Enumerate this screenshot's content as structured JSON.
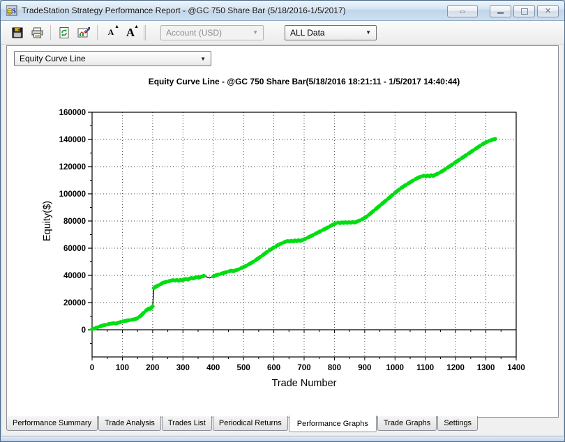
{
  "window": {
    "title": "TradeStation Strategy Performance Report - @GC 750 Share Bar (5/18/2016-1/5/2017)",
    "controls": {
      "resize_glyph": "⇔",
      "close_glyph": "✕"
    }
  },
  "toolbar": {
    "buttons": [
      "save",
      "print",
      "refresh",
      "format-report",
      "font-decrease",
      "font-increase"
    ],
    "account_combo": {
      "value": "Account (USD)",
      "disabled": true
    },
    "range_combo": {
      "value": "ALL Data",
      "disabled": false
    }
  },
  "graph_selector": {
    "value": "Equity Curve Line"
  },
  "tabs": {
    "items": [
      {
        "label": "Performance Summary",
        "active": false
      },
      {
        "label": "Trade Analysis",
        "active": false
      },
      {
        "label": "Trades List",
        "active": false
      },
      {
        "label": "Periodical Returns",
        "active": false
      },
      {
        "label": "Performance Graphs",
        "active": true
      },
      {
        "label": "Trade Graphs",
        "active": false
      },
      {
        "label": "Settings",
        "active": false
      }
    ]
  },
  "chart_data": {
    "type": "line",
    "title": "Equity Curve Line - @GC 750 Share Bar(5/18/2016 18:21:11 - 1/5/2017 14:40:44)",
    "xlabel": "Trade Number",
    "ylabel": "Equity($)",
    "xlim": [
      0,
      1400
    ],
    "ylim": [
      -20000,
      160000
    ],
    "x_major": 100,
    "x_minor": 50,
    "y_major": 20000,
    "y_minor": 10000,
    "grid": "dotted",
    "legend": "none",
    "line_color": "#000000",
    "new_high_color": "#00dd11",
    "series": [
      {
        "name": "Equity",
        "points": [
          [
            0,
            500
          ],
          [
            8,
            900
          ],
          [
            16,
            1600
          ],
          [
            24,
            2300
          ],
          [
            32,
            2900
          ],
          [
            40,
            3400
          ],
          [
            48,
            3800
          ],
          [
            56,
            4200
          ],
          [
            64,
            4500
          ],
          [
            72,
            4900
          ],
          [
            78,
            4600
          ],
          [
            84,
            5000
          ],
          [
            90,
            5400
          ],
          [
            98,
            5900
          ],
          [
            106,
            6300
          ],
          [
            114,
            6700
          ],
          [
            122,
            7000
          ],
          [
            130,
            7300
          ],
          [
            138,
            7600
          ],
          [
            146,
            8100
          ],
          [
            152,
            8800
          ],
          [
            158,
            9800
          ],
          [
            164,
            11000
          ],
          [
            170,
            12400
          ],
          [
            176,
            13700
          ],
          [
            182,
            14800
          ],
          [
            188,
            15700
          ],
          [
            192,
            15300
          ],
          [
            196,
            16300
          ],
          [
            200,
            17300
          ],
          [
            202,
            24000
          ],
          [
            204,
            30600
          ],
          [
            208,
            31400
          ],
          [
            214,
            32100
          ],
          [
            220,
            32800
          ],
          [
            226,
            33500
          ],
          [
            232,
            34300
          ],
          [
            238,
            34800
          ],
          [
            244,
            35200
          ],
          [
            250,
            35600
          ],
          [
            256,
            35900
          ],
          [
            262,
            36200
          ],
          [
            268,
            36500
          ],
          [
            274,
            36100
          ],
          [
            280,
            36600
          ],
          [
            286,
            36000
          ],
          [
            292,
            36700
          ],
          [
            298,
            36300
          ],
          [
            304,
            37000
          ],
          [
            310,
            37400
          ],
          [
            316,
            36900
          ],
          [
            322,
            37600
          ],
          [
            328,
            38100
          ],
          [
            334,
            37700
          ],
          [
            340,
            38300
          ],
          [
            346,
            38700
          ],
          [
            352,
            38300
          ],
          [
            358,
            38900
          ],
          [
            364,
            39300
          ],
          [
            370,
            39700
          ],
          [
            376,
            39100
          ],
          [
            382,
            38500
          ],
          [
            388,
            38100
          ],
          [
            394,
            38700
          ],
          [
            400,
            39200
          ],
          [
            406,
            39800
          ],
          [
            412,
            40300
          ],
          [
            418,
            40700
          ],
          [
            424,
            41100
          ],
          [
            430,
            41500
          ],
          [
            436,
            41900
          ],
          [
            442,
            42300
          ],
          [
            448,
            42700
          ],
          [
            454,
            43100
          ],
          [
            460,
            43500
          ],
          [
            466,
            43000
          ],
          [
            472,
            43600
          ],
          [
            478,
            44000
          ],
          [
            484,
            44500
          ],
          [
            490,
            45100
          ],
          [
            496,
            45700
          ],
          [
            502,
            46300
          ],
          [
            510,
            47200
          ],
          [
            518,
            48200
          ],
          [
            526,
            49200
          ],
          [
            534,
            50300
          ],
          [
            542,
            51500
          ],
          [
            550,
            52700
          ],
          [
            558,
            54000
          ],
          [
            566,
            55300
          ],
          [
            574,
            56600
          ],
          [
            582,
            57900
          ],
          [
            590,
            59100
          ],
          [
            598,
            60200
          ],
          [
            606,
            61300
          ],
          [
            614,
            62300
          ],
          [
            622,
            63200
          ],
          [
            630,
            64000
          ],
          [
            638,
            64700
          ],
          [
            646,
            65300
          ],
          [
            652,
            64900
          ],
          [
            658,
            65500
          ],
          [
            664,
            65000
          ],
          [
            670,
            65700
          ],
          [
            676,
            65200
          ],
          [
            682,
            65900
          ],
          [
            688,
            65400
          ],
          [
            694,
            66000
          ],
          [
            700,
            66500
          ],
          [
            708,
            67300
          ],
          [
            716,
            68200
          ],
          [
            724,
            69100
          ],
          [
            732,
            70000
          ],
          [
            740,
            70900
          ],
          [
            748,
            71800
          ],
          [
            756,
            72700
          ],
          [
            764,
            73600
          ],
          [
            772,
            74500
          ],
          [
            780,
            75500
          ],
          [
            788,
            76500
          ],
          [
            796,
            77400
          ],
          [
            804,
            78200
          ],
          [
            812,
            78900
          ],
          [
            818,
            78400
          ],
          [
            824,
            79000
          ],
          [
            830,
            78500
          ],
          [
            836,
            79100
          ],
          [
            842,
            78600
          ],
          [
            848,
            79200
          ],
          [
            854,
            78700
          ],
          [
            860,
            79300
          ],
          [
            866,
            78800
          ],
          [
            872,
            79400
          ],
          [
            878,
            79900
          ],
          [
            886,
            80600
          ],
          [
            894,
            81500
          ],
          [
            902,
            82600
          ],
          [
            910,
            83900
          ],
          [
            918,
            85300
          ],
          [
            926,
            86800
          ],
          [
            934,
            88300
          ],
          [
            942,
            89800
          ],
          [
            950,
            91300
          ],
          [
            958,
            92800
          ],
          [
            966,
            94300
          ],
          [
            974,
            95800
          ],
          [
            982,
            97300
          ],
          [
            990,
            98800
          ],
          [
            998,
            100300
          ],
          [
            1006,
            101800
          ],
          [
            1014,
            103200
          ],
          [
            1022,
            104500
          ],
          [
            1030,
            105700
          ],
          [
            1038,
            106800
          ],
          [
            1046,
            107900
          ],
          [
            1054,
            109000
          ],
          [
            1062,
            110100
          ],
          [
            1070,
            111100
          ],
          [
            1078,
            112000
          ],
          [
            1086,
            112700
          ],
          [
            1094,
            113300
          ],
          [
            1102,
            112800
          ],
          [
            1108,
            113500
          ],
          [
            1114,
            113000
          ],
          [
            1120,
            113700
          ],
          [
            1126,
            113200
          ],
          [
            1132,
            113900
          ],
          [
            1138,
            114500
          ],
          [
            1146,
            115400
          ],
          [
            1154,
            116400
          ],
          [
            1162,
            117500
          ],
          [
            1170,
            118700
          ],
          [
            1178,
            119900
          ],
          [
            1186,
            121100
          ],
          [
            1194,
            122300
          ],
          [
            1202,
            123500
          ],
          [
            1210,
            124700
          ],
          [
            1218,
            125900
          ],
          [
            1226,
            127100
          ],
          [
            1234,
            128300
          ],
          [
            1242,
            129500
          ],
          [
            1250,
            130700
          ],
          [
            1258,
            131900
          ],
          [
            1266,
            133100
          ],
          [
            1274,
            134300
          ],
          [
            1282,
            135500
          ],
          [
            1290,
            136600
          ],
          [
            1298,
            137600
          ],
          [
            1306,
            138500
          ],
          [
            1314,
            139200
          ],
          [
            1322,
            139800
          ],
          [
            1330,
            140300
          ],
          [
            1336,
            140600
          ]
        ]
      }
    ]
  }
}
